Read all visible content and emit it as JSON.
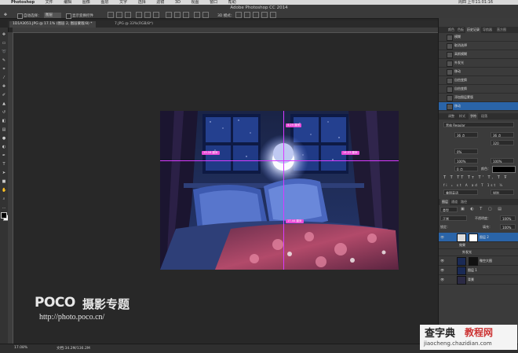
{
  "menubar": {
    "app_name": "Photoshop",
    "items": [
      "文件",
      "编辑",
      "图像",
      "图层",
      "文字",
      "选择",
      "滤镜",
      "3D",
      "视图",
      "窗口",
      "帮助"
    ],
    "clock": "周四 上午11:01:16"
  },
  "window": {
    "title": "Adobe Photoshop CC 2014"
  },
  "options_bar": {
    "auto_select_label": "自动选择：",
    "auto_select_value": "图层",
    "show_transform_label": "显示变换控件",
    "mode_3d_label": "3D 模式："
  },
  "doc_tabs": [
    {
      "label": "1D1A3051.JPG @ 17.1% (图层 2, 图层蒙版/8) *",
      "active": true
    },
    {
      "label": "7.JPG @ 33%(RGB/8*)",
      "active": false
    }
  ],
  "photo_labels": {
    "top": "4.25 厘米",
    "left": "13.16 厘米",
    "right": "14.23 厘米",
    "bottom": "17.44 厘米"
  },
  "status": {
    "zoom": "17.08%",
    "doc_size": "文档:34.2M/136.2M"
  },
  "panels": {
    "top_tabs": [
      "颜色",
      "色板",
      "历史记录",
      "导航器",
      "直方图"
    ],
    "history_items": [
      "模糊",
      "取消选择",
      "高斯模糊",
      "外发光",
      "移动",
      "自由变换",
      "自由变换",
      "添加图层蒙版",
      "移动"
    ],
    "char_tabs": [
      "调整",
      "样式",
      "字符",
      "段落"
    ],
    "font_name": "黑体 Regular",
    "font_size": "36 点",
    "leading": "36 点",
    "tracking": "320",
    "kerning": "0%",
    "scale_v": "100%",
    "scale_h": "100%",
    "baseline": "0 点",
    "color_label": "颜色：",
    "lang": "美国英语",
    "aa": "锐利",
    "layer_tabs": [
      "图层",
      "通道",
      "路径"
    ],
    "layer_kind": "类型",
    "blend_mode": "正常",
    "opacity_label": "不透明度：",
    "opacity": "100%",
    "lock_label": "锁定：",
    "fill_label": "填充：",
    "fill": "100%",
    "layers": [
      {
        "name": "图层 2",
        "active": true,
        "has_mask": true
      },
      {
        "name": "效果",
        "sub": true
      },
      {
        "name": "外发光",
        "sub": true
      },
      {
        "name": "微空大图",
        "active": false,
        "has_mask": true
      },
      {
        "name": "图层 1",
        "active": false
      },
      {
        "name": "背景",
        "active": false
      }
    ]
  },
  "watermark": {
    "brand": "POCO",
    "brand_suffix": "摄影专题",
    "url": "http://photo.poco.cn/"
  },
  "corner_watermark": {
    "title": "查字典",
    "title2": "教程网",
    "url": "jiaocheng.chazidian.com"
  }
}
